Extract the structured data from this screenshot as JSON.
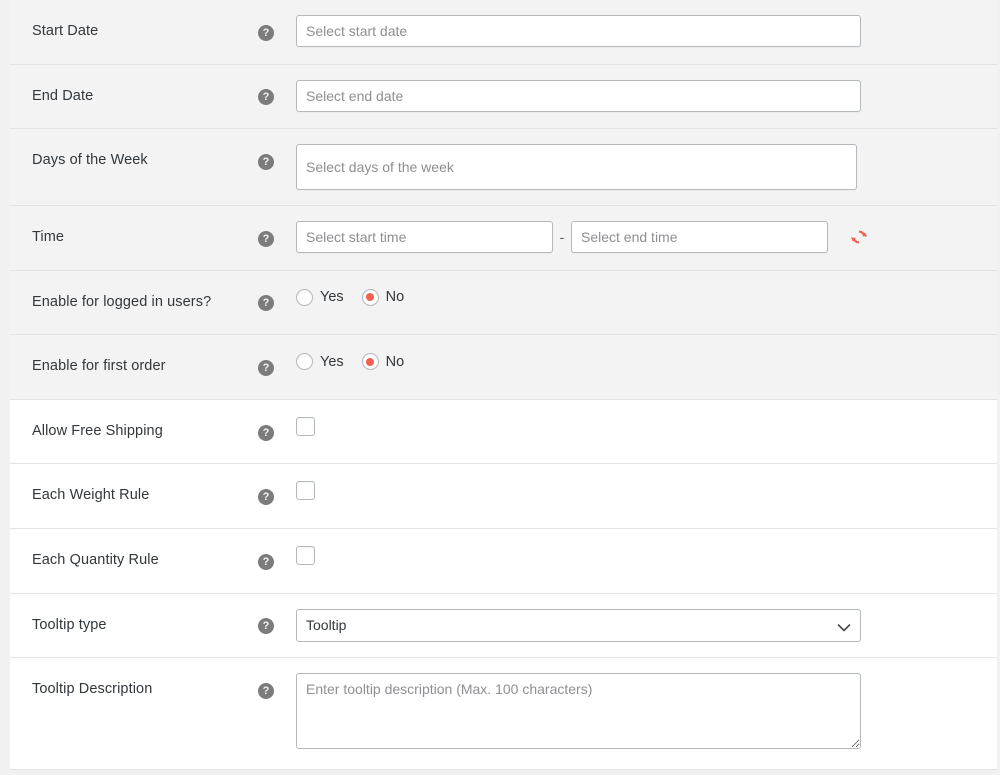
{
  "colors": {
    "accent": "#f2614f",
    "row_shaded_bg": "#f3f3f3",
    "row_plain_bg": "#ffffff",
    "page_bg": "#f1f1f1",
    "border": "#e3e3e3",
    "input_border": "#b4b9be",
    "label_text": "#32373c",
    "placeholder_text": "#8d8f92",
    "help_icon_bg": "#7c7c7c"
  },
  "help_icon_glyph": "?",
  "rows": [
    {
      "key": "start_date",
      "label": "Start Date",
      "shaded": true,
      "control": "text",
      "placeholder": "Select start date",
      "value": ""
    },
    {
      "key": "end_date",
      "label": "End Date",
      "shaded": true,
      "control": "text",
      "placeholder": "Select end date",
      "value": ""
    },
    {
      "key": "days_of_week",
      "label": "Days of the Week",
      "shaded": true,
      "control": "multiselect",
      "placeholder": "Select days of the week",
      "value": ""
    },
    {
      "key": "time",
      "label": "Time",
      "shaded": true,
      "control": "time_range",
      "start_placeholder": "Select start time",
      "end_placeholder": "Select end time",
      "separator": "-",
      "start_value": "",
      "end_value": "",
      "reset_icon": "sync-refresh-icon"
    },
    {
      "key": "enable_logged_in",
      "label": "Enable for logged in users?",
      "shaded": true,
      "control": "radio",
      "options": [
        "Yes",
        "No"
      ],
      "selected": "No"
    },
    {
      "key": "enable_first_order",
      "label": "Enable for first order",
      "shaded": true,
      "control": "radio",
      "options": [
        "Yes",
        "No"
      ],
      "selected": "No"
    },
    {
      "key": "allow_free_shipping",
      "label": "Allow Free Shipping",
      "shaded": false,
      "control": "checkbox",
      "checked": false
    },
    {
      "key": "each_weight_rule",
      "label": "Each Weight Rule",
      "shaded": false,
      "control": "checkbox",
      "checked": false
    },
    {
      "key": "each_quantity_rule",
      "label": "Each Quantity Rule",
      "shaded": false,
      "control": "checkbox",
      "checked": false
    },
    {
      "key": "tooltip_type",
      "label": "Tooltip type",
      "shaded": false,
      "control": "select",
      "value": "Tooltip",
      "options": [
        "Tooltip"
      ]
    },
    {
      "key": "tooltip_description",
      "label": "Tooltip Description",
      "shaded": false,
      "control": "textarea",
      "placeholder": "Enter tooltip description (Max. 100 characters)",
      "value": ""
    }
  ]
}
